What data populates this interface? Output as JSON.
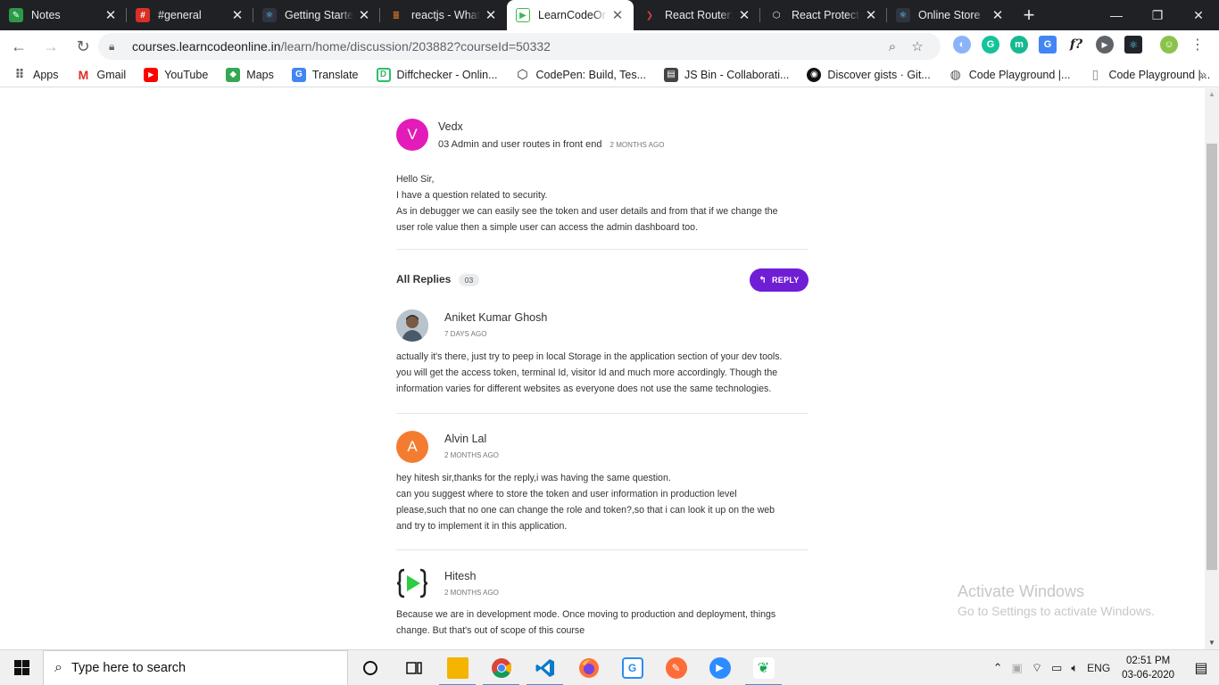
{
  "browser": {
    "tabs": [
      {
        "title": "Notes",
        "icon": "notes-icon",
        "color": "#2b9a48",
        "active": false
      },
      {
        "title": "#general",
        "icon": "slack-icon",
        "color": "#d93025",
        "active": false
      },
      {
        "title": "Getting Started",
        "icon": "react-icon",
        "color": "#61dafb",
        "active": false
      },
      {
        "title": "reactjs - What",
        "icon": "stackoverflow-icon",
        "color": "#f48024",
        "active": false
      },
      {
        "title": "LearnCodeOnline",
        "icon": "lco-icon",
        "color": "#3fb950",
        "active": true
      },
      {
        "title": "React Router: D",
        "icon": "react-router-icon",
        "color": "#ca4245",
        "active": false
      },
      {
        "title": "React Protected",
        "icon": "codesandbox-icon",
        "color": "#e8eaed",
        "active": false
      },
      {
        "title": "Online Store",
        "icon": "react-icon",
        "color": "#61dafb",
        "active": false
      }
    ],
    "url_host": "courses.learncodeonline.in",
    "url_path": "/learn/home/discussion/203882?courseId=50332",
    "bookmarks": [
      {
        "label": "Apps",
        "icon": "apps-grid-icon",
        "color": "#5f6368"
      },
      {
        "label": "Gmail",
        "icon": "gmail-icon",
        "color": "#d93025"
      },
      {
        "label": "YouTube",
        "icon": "youtube-icon",
        "color": "#ff0000"
      },
      {
        "label": "Maps",
        "icon": "maps-icon",
        "color": "#34a853"
      },
      {
        "label": "Translate",
        "icon": "translate-icon",
        "color": "#4285f4"
      },
      {
        "label": "Diffchecker - Onlin...",
        "icon": "diffchecker-icon",
        "color": "#2bbf6a"
      },
      {
        "label": "CodePen: Build, Tes...",
        "icon": "codepen-icon",
        "color": "#222222"
      },
      {
        "label": "JS Bin - Collaborati...",
        "icon": "jsbin-icon",
        "color": "#444444"
      },
      {
        "label": "Discover gists · Git...",
        "icon": "github-icon",
        "color": "#111111"
      },
      {
        "label": "Code Playground |...",
        "icon": "globe-icon",
        "color": "#555555"
      },
      {
        "label": "Code Playground |...",
        "icon": "page-icon",
        "color": "#888888"
      }
    ]
  },
  "discussion": {
    "question": {
      "author": "Vedx",
      "avatar_letter": "V",
      "avatar_color": "#e31bb8",
      "topic": "03 Admin and user routes in front end",
      "time": "2 MONTHS AGO",
      "lines": [
        "Hello Sir,",
        "I have a question related to security.",
        "As in debugger we can easily see the token and user details and from that if we change the",
        "user role value then a simple user can access the admin dashboard too."
      ]
    },
    "replies_title": "All Replies",
    "replies_count": "03",
    "reply_button": "REPLY",
    "replies": [
      {
        "author": "Aniket Kumar Ghosh",
        "avatar": "photo",
        "time": "7 DAYS AGO",
        "lines": [
          "actually it's there, just try to peep in local Storage in the application section of your dev tools.",
          "you will get the access token, terminal Id, visitor Id and much more accordingly. Though the",
          "information varies for different websites as everyone does not use the same technologies."
        ]
      },
      {
        "author": "Alvin Lal",
        "avatar_letter": "A",
        "avatar_color": "#f47c30",
        "time": "2 MONTHS AGO",
        "lines": [
          "hey hitesh sir,thanks for the reply,i was having the same question.",
          "can you suggest where to store the token and user information in production level",
          "please,such that no one can change the role and token?,so that i can look it up on the web",
          "and try to implement it in this application."
        ]
      },
      {
        "author": "Hitesh",
        "avatar": "lco-logo",
        "time": "2 MONTHS AGO",
        "lines": [
          "Because we are in development mode. Once moving to production and deployment, things",
          "change. But that's out of scope of this course"
        ]
      }
    ]
  },
  "watermark": {
    "line1": "Activate Windows",
    "line2": "Go to Settings to activate Windows."
  },
  "taskbar": {
    "search_placeholder": "Type here to search",
    "language": "ENG",
    "time": "02:51 PM",
    "date": "03-06-2020",
    "apps": [
      {
        "name": "cortana-icon",
        "glyph": "O"
      },
      {
        "name": "task-view-icon",
        "glyph": "⧉"
      },
      {
        "name": "file-explorer-icon",
        "color": "#f4b400"
      },
      {
        "name": "chrome-icon",
        "color": "#4285f4"
      },
      {
        "name": "vscode-icon",
        "color": "#0a7ac9"
      },
      {
        "name": "firefox-icon",
        "color": "#ff7139"
      },
      {
        "name": "gitkraken-icon",
        "color": "#2d8cf0"
      },
      {
        "name": "postman-icon",
        "color": "#ff6c37"
      },
      {
        "name": "zoom-icon",
        "color": "#2d8cff"
      },
      {
        "name": "mongodb-compass-icon",
        "color": "#13aa52"
      }
    ]
  }
}
